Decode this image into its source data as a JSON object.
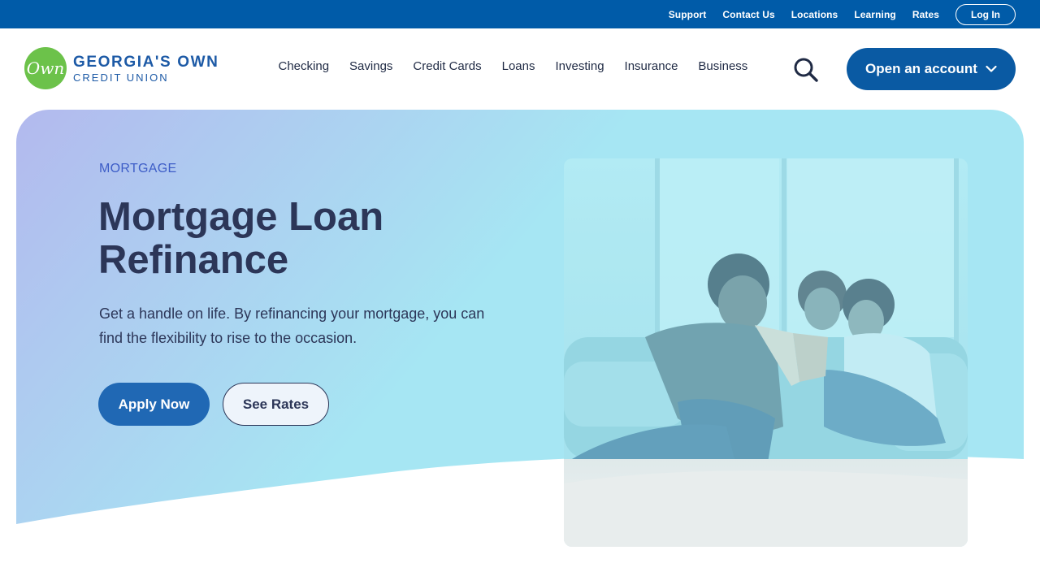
{
  "utility_nav": {
    "links": [
      "Support",
      "Contact Us",
      "Locations",
      "Learning",
      "Rates"
    ],
    "login_label": "Log In"
  },
  "brand": {
    "logo_mark": "Own",
    "name_line1": "GEORGIA'S OWN",
    "name_line2": "CREDIT UNION",
    "green": "#6cc24a",
    "blue": "#1d5aa6"
  },
  "primary_nav": {
    "items": [
      "Checking",
      "Savings",
      "Credit Cards",
      "Loans",
      "Investing",
      "Insurance",
      "Business"
    ],
    "search_icon": "search-icon",
    "open_account_label": "Open an account"
  },
  "hero": {
    "eyebrow": "MORTGAGE",
    "title": "Mortgage Loan Refinance",
    "description": "Get a handle on life. By refinancing your mortgage, you can find the flexibility to rise to the occasion.",
    "apply_label": "Apply Now",
    "rates_label": "See Rates",
    "gradient_start": "#b3b9ee",
    "gradient_end": "#a6e6f3"
  }
}
